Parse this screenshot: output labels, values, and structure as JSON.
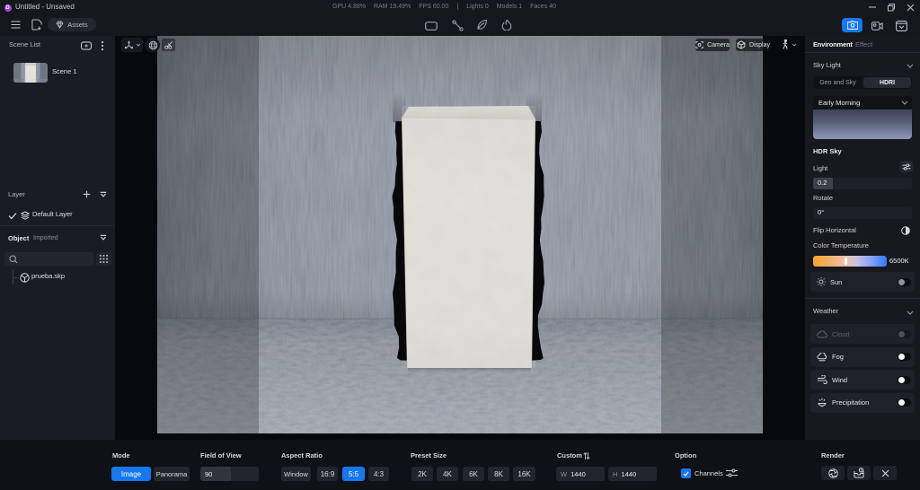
{
  "title_bar": {
    "title": "Untitled - Unsaved",
    "stats": [
      {
        "label": "GPU",
        "value": "4.88%"
      },
      {
        "label": "RAM",
        "value": "19.49%"
      },
      {
        "label": "FPS",
        "value": "60.00"
      }
    ],
    "separator": "|",
    "counts": [
      {
        "label": "Lights",
        "value": "0"
      },
      {
        "label": "Models",
        "value": "1"
      },
      {
        "label": "Faces",
        "value": "40"
      }
    ]
  },
  "toolbar": {
    "assets_label": "Assets"
  },
  "scene_panel": {
    "header": "Scene List",
    "scenes": [
      {
        "name": "Scene 1"
      }
    ]
  },
  "layer_panel": {
    "header": "Layer",
    "layers": [
      {
        "name": "Default Layer"
      }
    ]
  },
  "object_panel": {
    "header": "Object",
    "subtitle": "Imported",
    "items": [
      {
        "name": "prueba.skp"
      }
    ]
  },
  "viewport": {
    "camera_button": "Camera",
    "display_button": "Display"
  },
  "environment_panel": {
    "tabs": [
      {
        "label": "Environment"
      },
      {
        "label": "Effect"
      }
    ],
    "active_tab": "Environment",
    "sky_light": {
      "header": "Sky Light",
      "modes": [
        {
          "label": "Geo and Sky"
        },
        {
          "label": "HDRI"
        }
      ],
      "selected_mode": "HDRI",
      "preset": "Early Morning"
    },
    "hdr_sky": {
      "header": "HDR Sky",
      "light_label": "Light",
      "light_value": "0.2",
      "rotate_label": "Rotate",
      "rotate_value": "0°",
      "flip_label": "Flip Horizontal",
      "color_temp_label": "Color Temperature",
      "color_temp_value": "6500K",
      "sun_label": "Sun",
      "sun_on": false
    },
    "weather": {
      "header": "Weather",
      "rows": [
        {
          "label": "Cloud",
          "disabled": true,
          "on": false
        },
        {
          "label": "Fog",
          "disabled": false,
          "on": false
        },
        {
          "label": "Wind",
          "disabled": false,
          "on": false
        },
        {
          "label": "Precipitation",
          "disabled": false,
          "on": false
        }
      ]
    }
  },
  "render_bar": {
    "mode": {
      "label": "Mode",
      "options": [
        {
          "label": "Image"
        },
        {
          "label": "Panorama"
        }
      ],
      "selected": "Image"
    },
    "fov": {
      "label": "Field of View",
      "value": "90"
    },
    "aspect": {
      "label": "Aspect Ratio",
      "options": [
        {
          "label": "Window"
        },
        {
          "label": "16:9"
        },
        {
          "label": "5:5"
        },
        {
          "label": "4:3"
        }
      ],
      "selected": "5:5"
    },
    "preset": {
      "label": "Preset Size",
      "options": [
        {
          "label": "2K"
        },
        {
          "label": "4K"
        },
        {
          "label": "6K"
        },
        {
          "label": "8K"
        },
        {
          "label": "16K"
        }
      ]
    },
    "custom": {
      "label": "Custom",
      "w_label": "W",
      "w_value": "1440",
      "h_label": "H",
      "h_value": "1440"
    },
    "option": {
      "label": "Option",
      "channels_label": "Channels",
      "channels_checked": true
    },
    "render": {
      "label": "Render"
    }
  },
  "colors": {
    "accent": "#1677f1",
    "temp_value": "6500K"
  }
}
